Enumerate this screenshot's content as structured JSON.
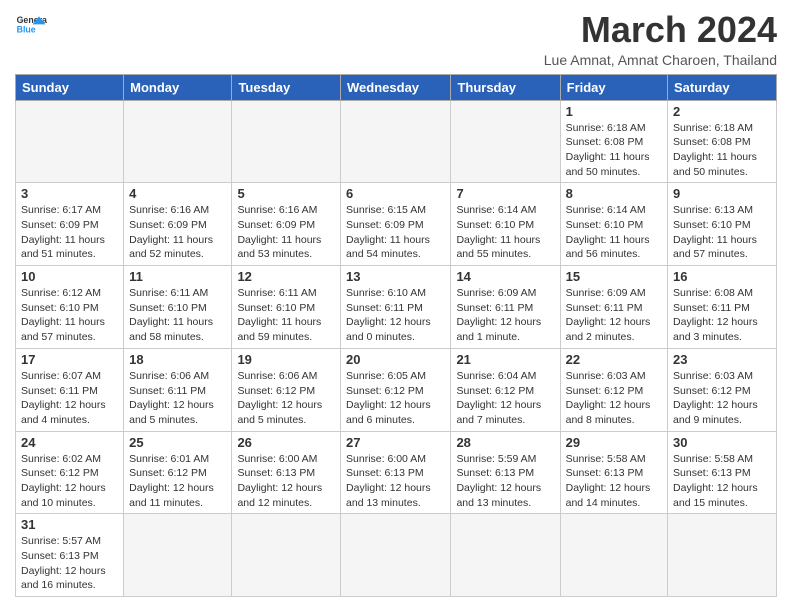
{
  "header": {
    "logo_general": "General",
    "logo_blue": "Blue",
    "title": "March 2024",
    "location": "Lue Amnat, Amnat Charoen, Thailand"
  },
  "weekdays": [
    "Sunday",
    "Monday",
    "Tuesday",
    "Wednesday",
    "Thursday",
    "Friday",
    "Saturday"
  ],
  "weeks": [
    [
      {
        "day": "",
        "info": ""
      },
      {
        "day": "",
        "info": ""
      },
      {
        "day": "",
        "info": ""
      },
      {
        "day": "",
        "info": ""
      },
      {
        "day": "",
        "info": ""
      },
      {
        "day": "1",
        "info": "Sunrise: 6:18 AM\nSunset: 6:08 PM\nDaylight: 11 hours\nand 50 minutes."
      },
      {
        "day": "2",
        "info": "Sunrise: 6:18 AM\nSunset: 6:08 PM\nDaylight: 11 hours\nand 50 minutes."
      }
    ],
    [
      {
        "day": "3",
        "info": "Sunrise: 6:17 AM\nSunset: 6:09 PM\nDaylight: 11 hours\nand 51 minutes."
      },
      {
        "day": "4",
        "info": "Sunrise: 6:16 AM\nSunset: 6:09 PM\nDaylight: 11 hours\nand 52 minutes."
      },
      {
        "day": "5",
        "info": "Sunrise: 6:16 AM\nSunset: 6:09 PM\nDaylight: 11 hours\nand 53 minutes."
      },
      {
        "day": "6",
        "info": "Sunrise: 6:15 AM\nSunset: 6:09 PM\nDaylight: 11 hours\nand 54 minutes."
      },
      {
        "day": "7",
        "info": "Sunrise: 6:14 AM\nSunset: 6:10 PM\nDaylight: 11 hours\nand 55 minutes."
      },
      {
        "day": "8",
        "info": "Sunrise: 6:14 AM\nSunset: 6:10 PM\nDaylight: 11 hours\nand 56 minutes."
      },
      {
        "day": "9",
        "info": "Sunrise: 6:13 AM\nSunset: 6:10 PM\nDaylight: 11 hours\nand 57 minutes."
      }
    ],
    [
      {
        "day": "10",
        "info": "Sunrise: 6:12 AM\nSunset: 6:10 PM\nDaylight: 11 hours\nand 57 minutes."
      },
      {
        "day": "11",
        "info": "Sunrise: 6:11 AM\nSunset: 6:10 PM\nDaylight: 11 hours\nand 58 minutes."
      },
      {
        "day": "12",
        "info": "Sunrise: 6:11 AM\nSunset: 6:10 PM\nDaylight: 11 hours\nand 59 minutes."
      },
      {
        "day": "13",
        "info": "Sunrise: 6:10 AM\nSunset: 6:11 PM\nDaylight: 12 hours\nand 0 minutes."
      },
      {
        "day": "14",
        "info": "Sunrise: 6:09 AM\nSunset: 6:11 PM\nDaylight: 12 hours\nand 1 minute."
      },
      {
        "day": "15",
        "info": "Sunrise: 6:09 AM\nSunset: 6:11 PM\nDaylight: 12 hours\nand 2 minutes."
      },
      {
        "day": "16",
        "info": "Sunrise: 6:08 AM\nSunset: 6:11 PM\nDaylight: 12 hours\nand 3 minutes."
      }
    ],
    [
      {
        "day": "17",
        "info": "Sunrise: 6:07 AM\nSunset: 6:11 PM\nDaylight: 12 hours\nand 4 minutes."
      },
      {
        "day": "18",
        "info": "Sunrise: 6:06 AM\nSunset: 6:11 PM\nDaylight: 12 hours\nand 5 minutes."
      },
      {
        "day": "19",
        "info": "Sunrise: 6:06 AM\nSunset: 6:12 PM\nDaylight: 12 hours\nand 5 minutes."
      },
      {
        "day": "20",
        "info": "Sunrise: 6:05 AM\nSunset: 6:12 PM\nDaylight: 12 hours\nand 6 minutes."
      },
      {
        "day": "21",
        "info": "Sunrise: 6:04 AM\nSunset: 6:12 PM\nDaylight: 12 hours\nand 7 minutes."
      },
      {
        "day": "22",
        "info": "Sunrise: 6:03 AM\nSunset: 6:12 PM\nDaylight: 12 hours\nand 8 minutes."
      },
      {
        "day": "23",
        "info": "Sunrise: 6:03 AM\nSunset: 6:12 PM\nDaylight: 12 hours\nand 9 minutes."
      }
    ],
    [
      {
        "day": "24",
        "info": "Sunrise: 6:02 AM\nSunset: 6:12 PM\nDaylight: 12 hours\nand 10 minutes."
      },
      {
        "day": "25",
        "info": "Sunrise: 6:01 AM\nSunset: 6:12 PM\nDaylight: 12 hours\nand 11 minutes."
      },
      {
        "day": "26",
        "info": "Sunrise: 6:00 AM\nSunset: 6:13 PM\nDaylight: 12 hours\nand 12 minutes."
      },
      {
        "day": "27",
        "info": "Sunrise: 6:00 AM\nSunset: 6:13 PM\nDaylight: 12 hours\nand 13 minutes."
      },
      {
        "day": "28",
        "info": "Sunrise: 5:59 AM\nSunset: 6:13 PM\nDaylight: 12 hours\nand 13 minutes."
      },
      {
        "day": "29",
        "info": "Sunrise: 5:58 AM\nSunset: 6:13 PM\nDaylight: 12 hours\nand 14 minutes."
      },
      {
        "day": "30",
        "info": "Sunrise: 5:58 AM\nSunset: 6:13 PM\nDaylight: 12 hours\nand 15 minutes."
      }
    ],
    [
      {
        "day": "31",
        "info": "Sunrise: 5:57 AM\nSunset: 6:13 PM\nDaylight: 12 hours\nand 16 minutes."
      },
      {
        "day": "",
        "info": ""
      },
      {
        "day": "",
        "info": ""
      },
      {
        "day": "",
        "info": ""
      },
      {
        "day": "",
        "info": ""
      },
      {
        "day": "",
        "info": ""
      },
      {
        "day": "",
        "info": ""
      }
    ]
  ]
}
